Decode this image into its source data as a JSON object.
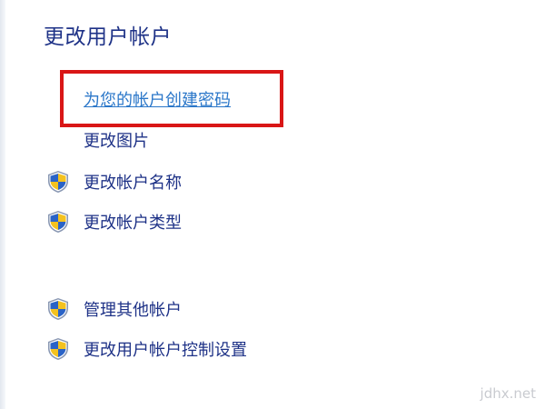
{
  "page": {
    "title": "更改用户帐户"
  },
  "tasks": [
    {
      "label": "为您的帐户创建密码",
      "icon": null,
      "style": "link"
    },
    {
      "label": "更改图片",
      "icon": null
    },
    {
      "label": "更改帐户名称",
      "icon": "uac-shield-icon"
    },
    {
      "label": "更改帐户类型",
      "icon": "uac-shield-icon"
    },
    {
      "label": "管理其他帐户",
      "icon": "uac-shield-icon"
    },
    {
      "label": "更改用户帐户控制设置",
      "icon": "uac-shield-icon"
    }
  ],
  "highlight": {
    "target": "为您的帐户创建密码",
    "color": "#d91616"
  },
  "watermark": "jdhx.net",
  "colors": {
    "title": "#1e3287",
    "task_text": "#1e3287",
    "link": "#2b77c9",
    "shield_blue": "#2a63c7",
    "shield_yellow": "#f4c21f"
  }
}
